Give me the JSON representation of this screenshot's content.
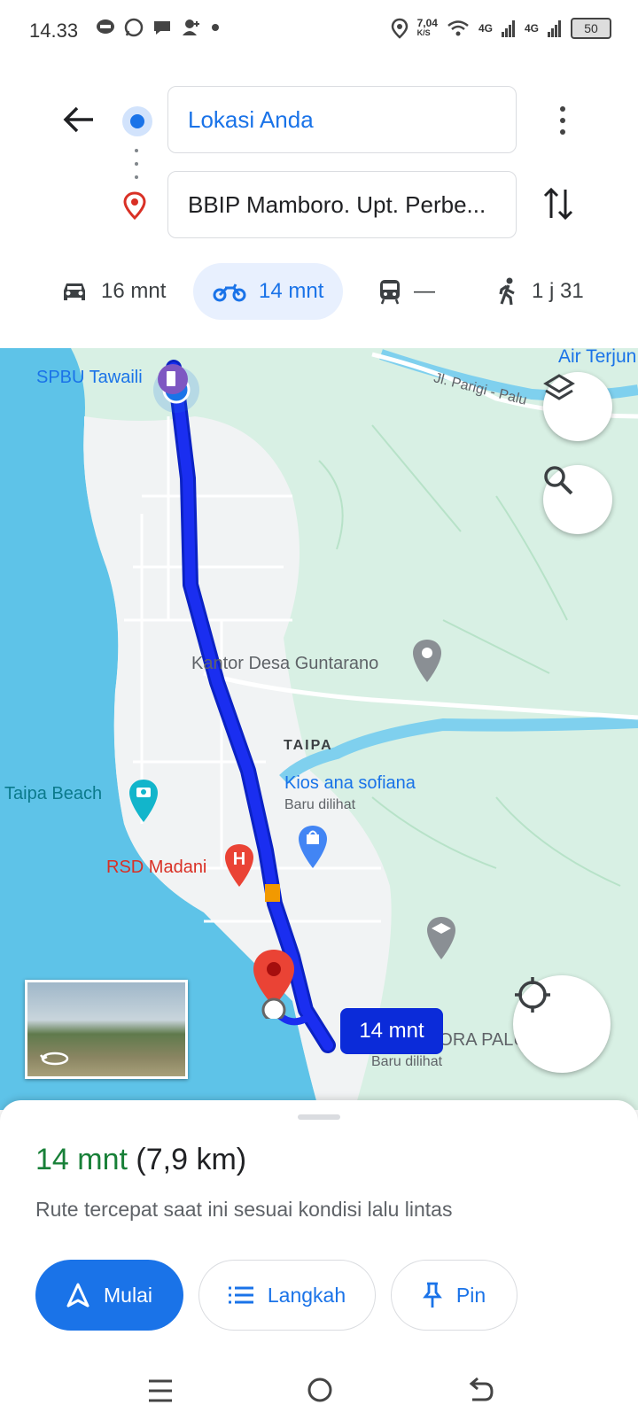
{
  "status_bar": {
    "time": "14.33",
    "speed_value": "7,04",
    "speed_unit": "K/S",
    "network_1": "4G",
    "network_2": "4G",
    "battery": "50"
  },
  "directions": {
    "origin": "Lokasi Anda",
    "destination": "BBIP Mamboro. Upt. Perbe..."
  },
  "modes": [
    {
      "icon": "car-icon",
      "label": "16 mnt",
      "selected": false
    },
    {
      "icon": "motorcycle-icon",
      "label": "14 mnt",
      "selected": true
    },
    {
      "icon": "transit-icon",
      "label": "—",
      "selected": false
    },
    {
      "icon": "walk-icon",
      "label": "1 j 31",
      "selected": false
    }
  ],
  "map": {
    "labels": {
      "air_terjun": "Air Terjun",
      "road": "Jl. Parigi - Palu",
      "spbu": "SPBU Tawaili",
      "kantor_desa": "Kantor Desa Guntarano",
      "taipa": "TAIPA",
      "kios": "Kios ana sofiana",
      "kios_sub": "Baru dilihat",
      "taipa_beach": "Taipa Beach",
      "rsd": "RSD Madani",
      "mayora": "PT. MAYORA PALU",
      "mayora_sub": "Baru dilihat"
    },
    "eta_bubble": "14 mnt",
    "colors": {
      "route": "#1a2ef0",
      "water": "#5ec3e8",
      "land": "#d8f0e4",
      "urban": "#f1f3f4"
    }
  },
  "sheet": {
    "duration": "14 mnt",
    "distance": "(7,9 km)",
    "description": "Rute tercepat saat ini sesuai kondisi lalu lintas",
    "start_label": "Mulai",
    "steps_label": "Langkah",
    "pin_label": "Pin"
  }
}
